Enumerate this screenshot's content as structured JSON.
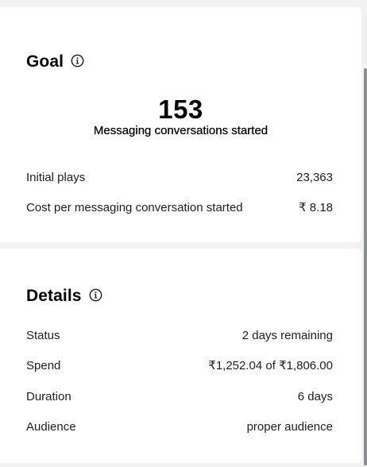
{
  "goal": {
    "title": "Goal",
    "icon": "info-icon",
    "result_value": "153",
    "result_label": "Messaging conversations started",
    "metrics": [
      {
        "label": "Initial plays",
        "value": "23,363"
      },
      {
        "label": "Cost per messaging conversation started",
        "value": "₹ 8.18"
      }
    ]
  },
  "details": {
    "title": "Details",
    "icon": "info-icon",
    "rows": [
      {
        "label": "Status",
        "value": "2 days remaining"
      },
      {
        "label": "Spend",
        "value": "₹1,252.04 of ₹1,806.00"
      },
      {
        "label": "Duration",
        "value": "6 days"
      },
      {
        "label": "Audience",
        "value": "proper audience"
      }
    ]
  },
  "colors": {
    "background": "#f2f2f2",
    "card": "#ffffff",
    "text": "#1c1e21",
    "scrollbar": "#8a8d91"
  }
}
